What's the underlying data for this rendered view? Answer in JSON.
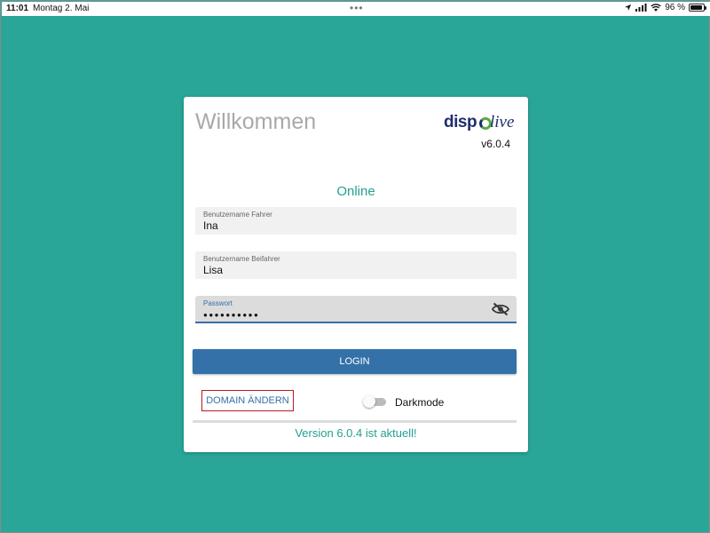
{
  "statusbar": {
    "time": "11:01",
    "date": "Montag 2. Mai",
    "dots": "•••",
    "battery": "96 %",
    "battery_level": 0.96
  },
  "card": {
    "title": "Willkommen",
    "logo": {
      "part1": "disp",
      "part2": "live"
    },
    "version": "v6.0.4",
    "status": "Online",
    "fields": {
      "driver": {
        "label": "Benutzername Fahrer",
        "value": "Ina"
      },
      "codriver": {
        "label": "Benutzername Beifahrer",
        "value": "Lisa"
      },
      "password": {
        "label": "Passwort",
        "value": "●●●●●●●●●●"
      }
    },
    "login_label": "LOGIN",
    "domain_label": "DOMAIN ÄNDERN",
    "darkmode_label": "Darkmode",
    "darkmode_on": false,
    "version_message": "Version 6.0.4 ist aktuell!"
  },
  "colors": {
    "background": "#29a698",
    "accent": "#23a090",
    "button": "#3471a8",
    "logo_dark": "#1d2f6b",
    "logo_green": "#5aaa46",
    "highlight_border": "#b31b24"
  }
}
